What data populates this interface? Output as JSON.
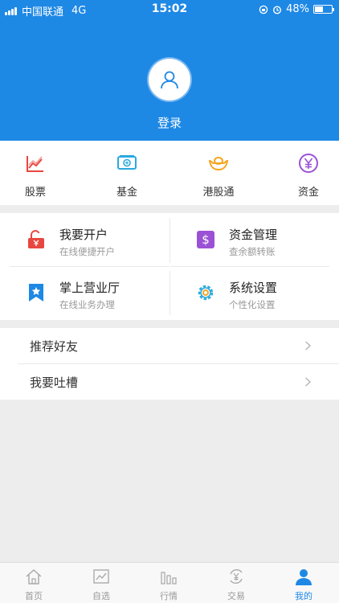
{
  "statusbar": {
    "carrier": "中国联通",
    "network": "4G",
    "time": "15:02",
    "battery": "48%",
    "battery_level": 0.48
  },
  "header": {
    "login_label": "登录",
    "color": "#1e88e5"
  },
  "quick": [
    {
      "label": "股票",
      "icon": "stock-chart-icon",
      "color": "#e8473f"
    },
    {
      "label": "基金",
      "icon": "fund-cash-icon",
      "color": "#29a9e1"
    },
    {
      "label": "港股通",
      "icon": "hk-ingot-icon",
      "color": "#f5a623"
    },
    {
      "label": "资金",
      "icon": "yen-coin-icon",
      "color": "#9b51d6"
    }
  ],
  "grid": [
    {
      "title": "我要开户",
      "subtitle": "在线便捷开户",
      "icon": "open-account-lock-icon",
      "color": "#e8473f"
    },
    {
      "title": "资金管理",
      "subtitle": "查余额转账",
      "icon": "dollar-square-icon",
      "color": "#9b51d6"
    },
    {
      "title": "掌上营业厅",
      "subtitle": "在线业务办理",
      "icon": "star-bookmark-icon",
      "color": "#1e88e5"
    },
    {
      "title": "系统设置",
      "subtitle": "个性化设置",
      "icon": "gear-icon",
      "color": "#f5a623"
    }
  ],
  "list": [
    {
      "label": "推荐好友"
    },
    {
      "label": "我要吐槽"
    }
  ],
  "tabs": [
    {
      "label": "首页",
      "icon": "home-icon"
    },
    {
      "label": "自选",
      "icon": "watchlist-icon"
    },
    {
      "label": "行情",
      "icon": "market-bars-icon"
    },
    {
      "label": "交易",
      "icon": "trade-yen-icon"
    },
    {
      "label": "我的",
      "icon": "profile-icon",
      "active": true
    }
  ]
}
